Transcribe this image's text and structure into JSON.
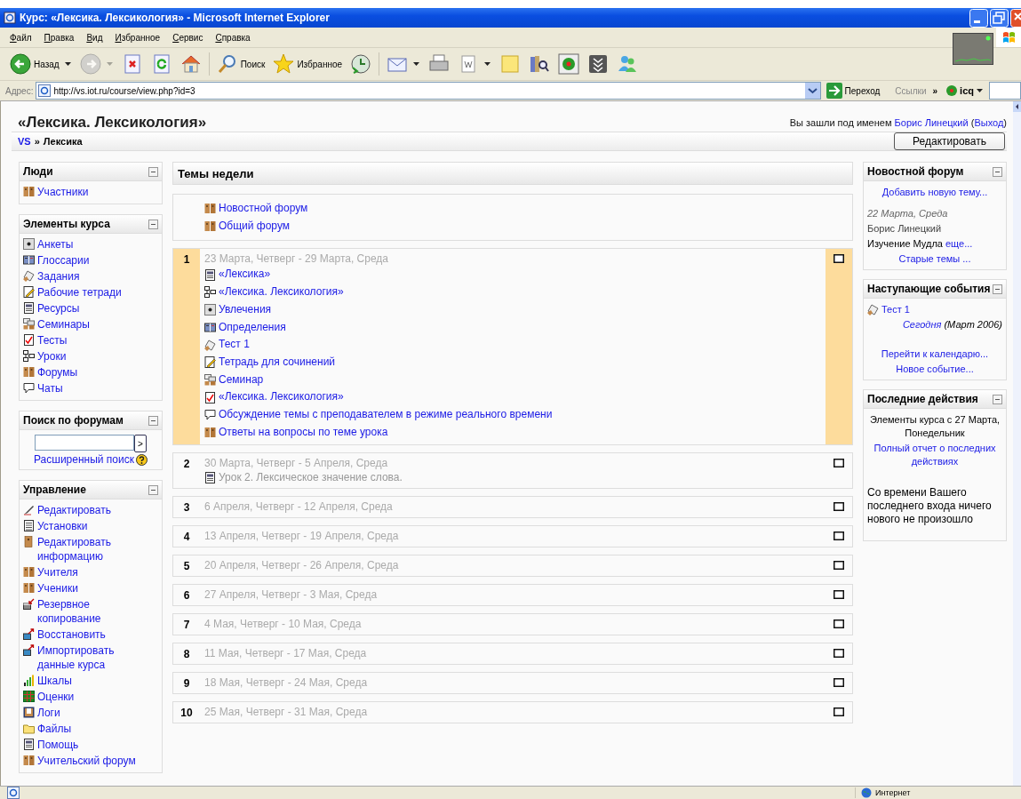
{
  "window": {
    "title": "Курс: «Лексика. Лексикология» - Microsoft Internet Explorer"
  },
  "menu": [
    "Файл",
    "Правка",
    "Вид",
    "Избранное",
    "Сервис",
    "Справка"
  ],
  "toolbar": [
    {
      "kind": "back",
      "label": "Назад",
      "dropdown": true,
      "disabled": false
    },
    {
      "kind": "forward",
      "dropdown": true,
      "disabled": true
    },
    {
      "kind": "stop",
      "disabled": false
    },
    {
      "kind": "refresh",
      "disabled": false
    },
    {
      "kind": "home",
      "disabled": false
    },
    {
      "kind": "search",
      "label": "Поиск",
      "disabled": false
    },
    {
      "kind": "favorites",
      "label": "Избранное",
      "disabled": false
    },
    {
      "kind": "history",
      "disabled": false
    },
    {
      "kind": "mail",
      "dropdown": true,
      "disabled": false
    },
    {
      "kind": "print",
      "disabled": false
    },
    {
      "kind": "word",
      "dropdown": true,
      "disabled": false
    },
    {
      "kind": "notes",
      "disabled": false
    },
    {
      "kind": "research",
      "disabled": false
    },
    {
      "kind": "icq",
      "disabled": false
    },
    {
      "kind": "download",
      "disabled": false
    },
    {
      "kind": "messenger",
      "disabled": false
    }
  ],
  "address_bar": {
    "label": "Адрес:",
    "url": "http://vs.iot.ru/course/view.php?id=3",
    "go": "Переход",
    "links": "Ссылки",
    "more": "»",
    "icq": "icq"
  },
  "page": {
    "title": "«Лексика. Лексикология»",
    "login": [
      {
        "kind": "text",
        "text": "Вы зашли под именем "
      },
      {
        "kind": "link",
        "text": "Борис Линецкий"
      },
      {
        "kind": "text",
        "text": " ("
      },
      {
        "kind": "link",
        "text": "Выход"
      },
      {
        "kind": "text",
        "text": ")"
      }
    ],
    "breadcrumb": [
      {
        "text": "VS",
        "link": true
      },
      {
        "text": "»",
        "link": false
      },
      {
        "text": "Лексика",
        "link": false
      }
    ],
    "edit_button": "Редактировать"
  },
  "left_blocks": [
    {
      "title": "Люди",
      "kind": "list",
      "items": [
        {
          "kind": "forum",
          "label": "Участники"
        }
      ]
    },
    {
      "title": "Элементы курса",
      "kind": "list",
      "items": [
        {
          "kind": "survey",
          "label": "Анкеты"
        },
        {
          "kind": "glossary",
          "label": "Глоссарии"
        },
        {
          "kind": "assignment",
          "label": "Задания"
        },
        {
          "kind": "workbook",
          "label": "Рабочие тетради"
        },
        {
          "kind": "resource",
          "label": "Ресурсы"
        },
        {
          "kind": "workshop",
          "label": "Семинары"
        },
        {
          "kind": "quiz",
          "label": "Тесты"
        },
        {
          "kind": "lesson",
          "label": "Уроки"
        },
        {
          "kind": "forum",
          "label": "Форумы"
        },
        {
          "kind": "chat",
          "label": "Чаты"
        }
      ]
    },
    {
      "title": "Поиск по форумам",
      "kind": "search",
      "button": ">",
      "advanced": "Расширенный поиск"
    },
    {
      "title": "Управление",
      "kind": "list",
      "items": [
        {
          "kind": "edit",
          "label": "Редактировать"
        },
        {
          "kind": "settings",
          "label": "Установки"
        },
        {
          "kind": "profile",
          "label": "Редактировать информацию"
        },
        {
          "kind": "forum",
          "label": "Учителя"
        },
        {
          "kind": "forum",
          "label": "Ученики"
        },
        {
          "kind": "backup",
          "label": "Резервное копирование"
        },
        {
          "kind": "restore",
          "label": "Восстановить"
        },
        {
          "kind": "restore",
          "label": "Импортировать данные курса"
        },
        {
          "kind": "scales",
          "label": "Шкалы"
        },
        {
          "kind": "grades",
          "label": "Оценки"
        },
        {
          "kind": "logs",
          "label": "Логи"
        },
        {
          "kind": "files",
          "label": "Файлы"
        },
        {
          "kind": "resource",
          "label": "Помощь"
        },
        {
          "kind": "forum",
          "label": "Учительский форум"
        }
      ]
    }
  ],
  "main": {
    "title": "Темы недели",
    "intro": [
      {
        "kind": "forum",
        "label": "Новостной форум",
        "hidden": false
      },
      {
        "kind": "forum",
        "label": "Общий форум",
        "hidden": false
      }
    ],
    "weeks": [
      {
        "number": "1",
        "dates": "23 Марта, Четверг - 29 Марта, Среда",
        "current": true,
        "items": [
          {
            "kind": "resource",
            "label": "«Лексика»",
            "hidden": false
          },
          {
            "kind": "lesson",
            "label": "«Лексика. Лексикология»",
            "hidden": false
          },
          {
            "kind": "survey",
            "label": "Увлечения",
            "hidden": false
          },
          {
            "kind": "glossary",
            "label": "Определения",
            "hidden": false
          },
          {
            "kind": "assignment",
            "label": "Тест 1",
            "hidden": false
          },
          {
            "kind": "workbook",
            "label": "Тетрадь для сочинений",
            "hidden": false
          },
          {
            "kind": "workshop",
            "label": "Семинар",
            "hidden": false
          },
          {
            "kind": "quiz",
            "label": "«Лексика. Лексикология»",
            "hidden": false
          },
          {
            "kind": "chat",
            "label": "Обсуждение темы с преподавателем в режиме реального времени",
            "hidden": false
          },
          {
            "kind": "forum",
            "label": "Ответы на вопросы по теме урока",
            "hidden": false
          }
        ]
      },
      {
        "number": "2",
        "dates": "30 Марта, Четверг - 5 Апреля, Среда",
        "current": false,
        "items": [
          {
            "kind": "resource",
            "label": "Урок 2. Лексическое значение слова.",
            "hidden": true
          }
        ]
      },
      {
        "number": "3",
        "dates": "6 Апреля, Четверг - 12 Апреля, Среда",
        "current": false
      },
      {
        "number": "4",
        "dates": "13 Апреля, Четверг - 19 Апреля, Среда",
        "current": false
      },
      {
        "number": "5",
        "dates": "20 Апреля, Четверг - 26 Апреля, Среда",
        "current": false
      },
      {
        "number": "6",
        "dates": "27 Апреля, Четверг - 3 Мая, Среда",
        "current": false
      },
      {
        "number": "7",
        "dates": "4 Мая, Четверг - 10 Мая, Среда",
        "current": false
      },
      {
        "number": "8",
        "dates": "11 Мая, Четверг - 17 Мая, Среда",
        "current": false
      },
      {
        "number": "9",
        "dates": "18 Мая, Четверг - 24 Мая, Среда",
        "current": false
      },
      {
        "number": "10",
        "dates": "25 Мая, Четверг - 31 Мая, Среда",
        "current": false
      }
    ]
  },
  "right_blocks": [
    {
      "title": "Новостной форум",
      "lines": [
        {
          "kind": "center-link",
          "parts": [
            {
              "kind": "link",
              "text": "Добавить новую тему..."
            }
          ]
        },
        {
          "kind": "date",
          "parts": [
            {
              "kind": "italic",
              "text": "22 Марта, Среда"
            }
          ]
        },
        {
          "kind": "author",
          "parts": [
            {
              "kind": "text",
              "text": "Борис Линецкий"
            }
          ]
        },
        {
          "kind": "post",
          "parts": [
            {
              "kind": "text",
              "text": "Изучение Мудла "
            },
            {
              "kind": "link",
              "text": "еще..."
            }
          ]
        },
        {
          "kind": "center-link",
          "parts": [
            {
              "kind": "link",
              "text": "Старые темы ..."
            }
          ]
        }
      ]
    },
    {
      "title": "Наступающие события",
      "lines": [
        {
          "kind": "event",
          "parts": [
            {
              "kind": "link",
              "text": "Тест 1"
            }
          ]
        },
        {
          "kind": "right",
          "parts": [
            {
              "kind": "italic-link",
              "text": "Сегодня"
            },
            {
              "kind": "italic",
              "text": " (Март 2006)"
            }
          ]
        },
        {
          "kind": "center-link",
          "parts": [
            {
              "kind": "link",
              "text": "Перейти к календарю..."
            }
          ]
        },
        {
          "kind": "center-link",
          "parts": [
            {
              "kind": "link",
              "text": "Новое событие..."
            }
          ]
        }
      ]
    },
    {
      "title": "Последние действия",
      "lines": [
        {
          "kind": "center",
          "parts": [
            {
              "kind": "text",
              "text": "Элементы курса с 27 Марта, Понедельник"
            }
          ]
        },
        {
          "kind": "center-link",
          "parts": [
            {
              "kind": "link",
              "text": "Полный отчет о последних действиях"
            }
          ]
        },
        {
          "kind": "para",
          "parts": [
            {
              "kind": "text",
              "text": "Со времени Вашего последнего входа ничего нового не произошло"
            }
          ]
        }
      ]
    }
  ],
  "status_bar": {
    "zone": "Интернет"
  }
}
